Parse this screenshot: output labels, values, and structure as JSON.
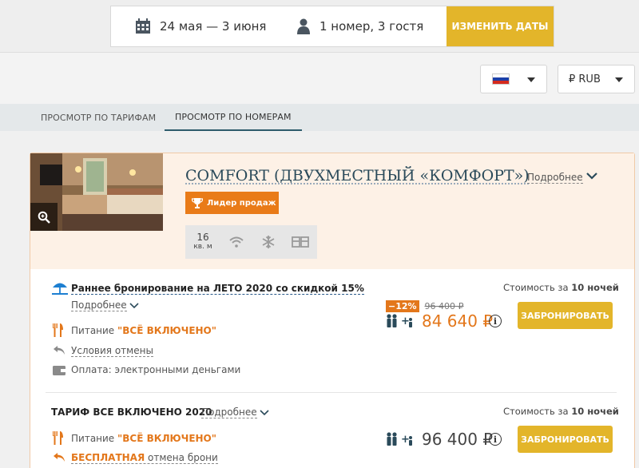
{
  "search": {
    "dates": "24 мая — 3 июня",
    "guests": "1 номер, 3 гостя",
    "change_label": "ИЗМЕНИТЬ ДАТЫ"
  },
  "selectors": {
    "language_flag": "russia-flag-icon",
    "currency": "₽ RUB"
  },
  "tabs": [
    {
      "label": "ПРОСМОТР ПО ТАРИФАМ",
      "active": false
    },
    {
      "label": "ПРОСМОТР ПО НОМЕРАМ",
      "active": true
    }
  ],
  "room": {
    "title": "COMFORT (ДВУХМЕСТНЫЙ «КОМФОРТ»)",
    "more": "Подробнее",
    "badge": "Лидер продаж",
    "area_value": "16",
    "area_unit": "кв. м",
    "amenity_icons": [
      "wifi-icon",
      "snowflake-icon",
      "twin-beds-icon"
    ]
  },
  "rates": [
    {
      "name": "Раннее бронирование на ЛЕТО 2020 со скидкой 15%",
      "more": "Подробнее",
      "meal_prefix": "Питание",
      "meal_value": "\"ВСЁ ВКЛЮЧЕНО\"",
      "cancel": "Условия отмены",
      "payment": "Оплата: электронными деньгами",
      "cost_label": "Стоимость за",
      "cost_nights": "10 ночей",
      "discount": "−12%",
      "old_price": "96 400 ₽",
      "price": "84 640 ₽",
      "guests_sign": "+",
      "book": "ЗАБРОНИРОВАТЬ"
    },
    {
      "name": "ТАРИФ ВСЕ ВКЛЮЧЕНО 2020",
      "more": "Подробнее",
      "meal_prefix": "Питание",
      "meal_value": "\"ВСЁ ВКЛЮЧЕНО\"",
      "cancel_bold": "БЕСПЛАТНАЯ",
      "cancel_rest": "отмена брони",
      "cost_label": "Стоимость за",
      "cost_nights": "10 ночей",
      "price": "96 400 ₽",
      "guests_sign": "+",
      "book": "ЗАБРОНИРОВАТЬ"
    }
  ],
  "colors": {
    "accent_yellow": "#e3b52a",
    "accent_orange": "#e3771b",
    "title_blue": "#2a4a5a"
  }
}
